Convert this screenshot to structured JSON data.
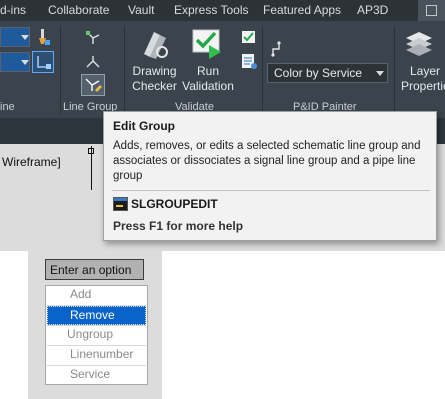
{
  "ribbon": {
    "tabs": [
      "d-ins",
      "Collaborate",
      "Vault",
      "Express Tools",
      "Featured Apps",
      "AP3D"
    ],
    "buttons": {
      "drawing_checker": [
        "Drawing",
        "Checker"
      ],
      "run_validation": [
        "Run",
        "Validation"
      ],
      "layer_properties": [
        "Layer",
        "Properties"
      ]
    },
    "combo_color": "Color by Service",
    "panels": {
      "line_panel_partial": "ine",
      "line_group": "Line Group",
      "validate": "Validate",
      "pid_painter": "P&ID Painter"
    }
  },
  "viewport": {
    "label": "Wireframe]"
  },
  "tooltip": {
    "title": "Edit Group",
    "description": "Adds, removes, or edits a selected schematic line group and associates or dissociates a signal line group and a pipe line group",
    "command": "SLGROUPEDIT",
    "help": "Press F1 for more help"
  },
  "prompt": {
    "label": "Enter an option"
  },
  "menu": {
    "options": [
      "Add",
      "Remove",
      "Ungroup",
      "Linenumber",
      "Service"
    ],
    "selected": "Remove"
  },
  "colors": {
    "ribbon_bg": "#3b444c",
    "tabbar_bg": "#2b3238",
    "selection_blue": "#0a63c9",
    "tooltip_bg": "#f2f2f2"
  }
}
